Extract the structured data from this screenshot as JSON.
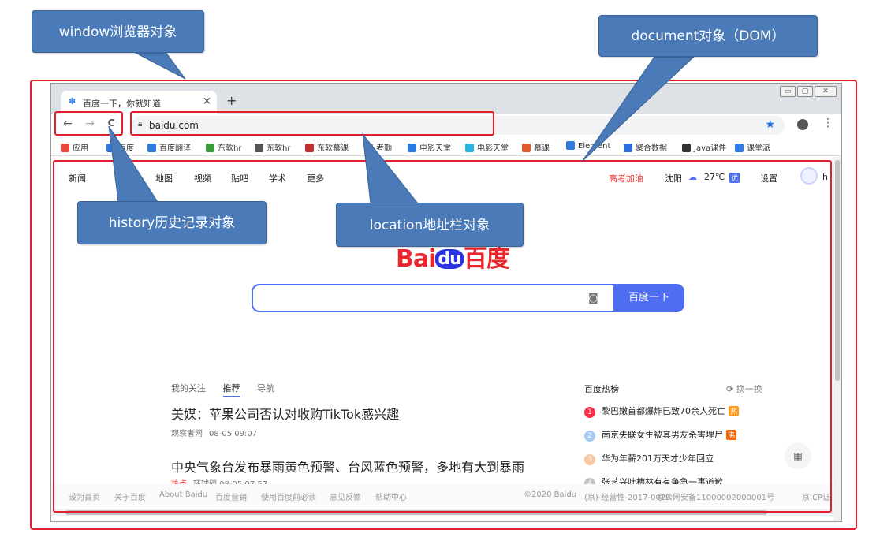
{
  "annotations": {
    "window": "window浏览器对象",
    "document": "document对象（DOM）",
    "history": "history历史记录对象",
    "location": "location地址栏对象"
  },
  "browser": {
    "tab_title": "百度一下，你就知道",
    "tab_close": "×",
    "new_tab": "+",
    "back": "←",
    "forward": "→",
    "reload": "C",
    "url": "baidu.com",
    "bookmark_star": "★",
    "menu": "⋮",
    "window_controls": [
      "▭",
      "▢",
      "✕"
    ]
  },
  "bookmarks": [
    {
      "label": "应用",
      "color": "#e84a3d"
    },
    {
      "label": "百度",
      "color": "#2d7be0"
    },
    {
      "label": "百度翻译",
      "color": "#2d7be0"
    },
    {
      "label": "东软hr",
      "color": "#3a9a3a"
    },
    {
      "label": "东软hr",
      "color": "#555555"
    },
    {
      "label": "东软慕课",
      "color": "#c03030"
    },
    {
      "label": "考勤",
      "color": "#888888"
    },
    {
      "label": "电影天堂",
      "color": "#2d7be0"
    },
    {
      "label": "电影天堂",
      "color": "#2db3e0"
    },
    {
      "label": "慕课",
      "color": "#e05a2d"
    },
    {
      "label": "Element",
      "color": "#2d7be0"
    },
    {
      "label": "聚合数据",
      "color": "#2d6ee0"
    },
    {
      "label": "Java课件",
      "color": "#333333"
    },
    {
      "label": "课堂派",
      "color": "#2d7be0"
    }
  ],
  "page": {
    "topnav_left": [
      "新闻",
      "地图",
      "视频",
      "贴吧",
      "学术",
      "更多"
    ],
    "topnav_right": {
      "hot": "高考加油",
      "city": "沈阳",
      "temp": "27℃",
      "quality": "优",
      "settings": "设置",
      "user_initial": "h"
    },
    "logo_left": "Bai",
    "logo_paw": "du",
    "logo_right": "百度",
    "search_button": "百度一下",
    "feed_tabs": [
      "我的关注",
      "推荐",
      "导航"
    ],
    "news": [
      {
        "title": "美媒：苹果公司否认对收购TikTok感兴趣",
        "source": "观察者网",
        "time": "08-05 09:07"
      },
      {
        "title": "中央气象台发布暴雨黄色预警、台风蓝色预警，多地有大到暴雨",
        "source": "热点",
        "time": "环球网 08-05 07:57"
      }
    ],
    "hotboard_title": "百度热榜",
    "refresh": "换一换",
    "hot_list": [
      {
        "rank": "1",
        "text": "黎巴嫩首都爆炸已致70余人死亡",
        "tag": "热",
        "tag_color": "#ff9812",
        "rank_color": "#fe2d46"
      },
      {
        "rank": "2",
        "text": "南京失联女生被其男友杀害埋尸",
        "tag": "沸",
        "tag_color": "#ff6600",
        "rank_color": "#a7c8f0"
      },
      {
        "rank": "3",
        "text": "华为年薪201万天才少年回应",
        "tag": "",
        "tag_color": "",
        "rank_color": "#f6c7a0"
      },
      {
        "rank": "4",
        "text": "张艺兴吐槽林有有争急一事道歉",
        "tag": "",
        "tag_color": "",
        "rank_color": "#c0c0c0"
      }
    ],
    "footer": [
      "设为首页",
      "关于百度",
      "About Baidu",
      "百度营销",
      "使用百度前必读",
      "意见反馈",
      "帮助中心",
      "©2020 Baidu",
      "(京)-经营性-2017-0020",
      "京公网安备11000002000001号",
      "京ICP证"
    ]
  }
}
